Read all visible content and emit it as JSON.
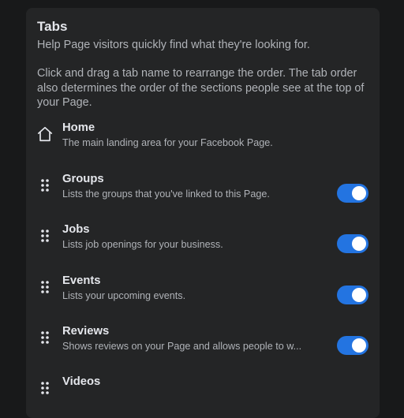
{
  "section": {
    "title": "Tabs",
    "description1": "Help Page visitors quickly find what they're looking for.",
    "description2": "Click and drag a tab name to rearrange the order. The tab order also determines the order of the sections people see at the top of your Page."
  },
  "tabs": [
    {
      "label": "Home",
      "description": "The main landing area for your Facebook Page.",
      "icon": "home-icon",
      "has_toggle": false
    },
    {
      "label": "Groups",
      "description": "Lists the groups that you've linked to this Page.",
      "icon": "drag-handle-icon",
      "has_toggle": true,
      "enabled": true
    },
    {
      "label": "Jobs",
      "description": "Lists job openings for your business.",
      "icon": "drag-handle-icon",
      "has_toggle": true,
      "enabled": true
    },
    {
      "label": "Events",
      "description": "Lists your upcoming events.",
      "icon": "drag-handle-icon",
      "has_toggle": true,
      "enabled": true
    },
    {
      "label": "Reviews",
      "description": "Shows reviews on your Page and allows people to w...",
      "icon": "drag-handle-icon",
      "has_toggle": true,
      "enabled": true
    },
    {
      "label": "Videos",
      "description": "",
      "icon": "drag-handle-icon",
      "has_toggle": false
    }
  ],
  "colors": {
    "background": "#18191a",
    "panel": "#242526",
    "toggle_on": "#2374e1",
    "primary_text": "#e4e6eb",
    "secondary_text": "#b0b3b8"
  }
}
